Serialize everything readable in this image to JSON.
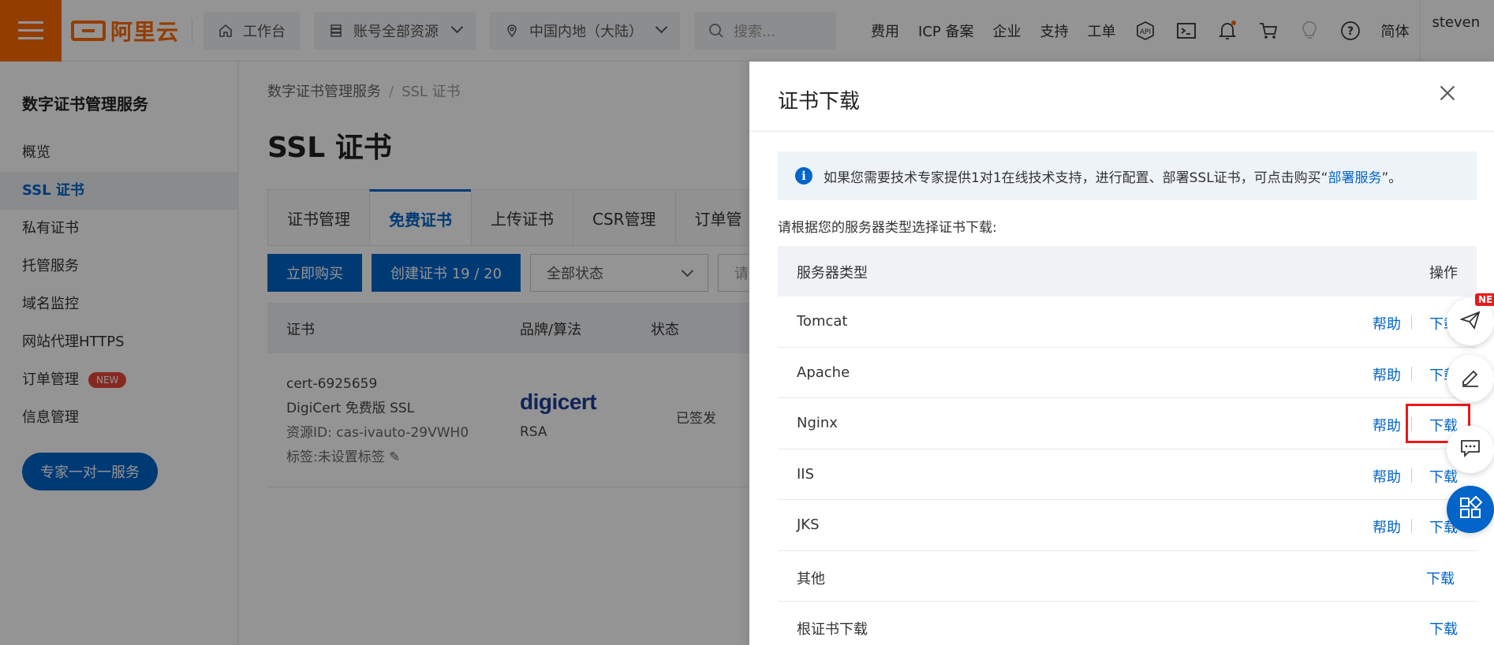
{
  "topbar": {
    "logo_text": "阿里云",
    "workbench": "工作台",
    "account_resources": "账号全部资源",
    "region": "中国内地（大陆）",
    "search_placeholder": "搜索...",
    "links": [
      "费用",
      "ICP 备案",
      "企业",
      "支持",
      "工单"
    ],
    "language": "简体",
    "user": "steven"
  },
  "sidebar": {
    "title": "数字证书管理服务",
    "items": [
      {
        "label": "概览"
      },
      {
        "label": "SSL 证书",
        "active": true
      },
      {
        "label": "私有证书"
      },
      {
        "label": "托管服务"
      },
      {
        "label": "域名监控"
      },
      {
        "label": "网站代理HTTPS"
      },
      {
        "label": "订单管理",
        "badge": "NEW"
      },
      {
        "label": "信息管理"
      }
    ],
    "expert_button": "专家一对一服务"
  },
  "main": {
    "breadcrumb": [
      "数字证书管理服务",
      "SSL 证书"
    ],
    "title": "SSL 证书",
    "tabs": [
      "证书管理",
      "免费证书",
      "上传证书",
      "CSR管理",
      "订单管"
    ],
    "active_tab": "免费证书",
    "buy_button": "立即购买",
    "create_button": "创建证书 19 / 20",
    "status_select": "全部状态",
    "input_stub": "请输",
    "table_headers": [
      "证书",
      "品牌/算法",
      "状态"
    ],
    "rows": [
      {
        "cert": "cert-6925659",
        "product": "DigiCert 免费版 SSL",
        "resource_id": "资源ID: cas-ivauto-29VWH0",
        "tag": "标签:未设置标签",
        "brand_logo": "digicert",
        "algorithm": "RSA",
        "status": "已签发"
      }
    ]
  },
  "drawer": {
    "title": "证书下载",
    "info_text": "如果您需要技术专家提供1对1在线技术支持，进行配置、部署SSL证书，可点击购买“",
    "info_link": "部署服务",
    "info_suffix": "”。",
    "select_label": "请根据您的服务器类型选择证书下载:",
    "col_server": "服务器类型",
    "col_action": "操作",
    "help_label": "帮助",
    "download_label": "下载",
    "servers": [
      {
        "name": "Tomcat",
        "help": "帮助",
        "download": "下载"
      },
      {
        "name": "Apache",
        "help": "帮助",
        "download": "下载"
      },
      {
        "name": "Nginx",
        "help": "帮助",
        "download": "下载",
        "highlighted": true
      },
      {
        "name": "IIS",
        "help": "帮助",
        "download": "下载"
      },
      {
        "name": "JKS",
        "help": "帮助",
        "download": "下载"
      },
      {
        "name": "其他",
        "download": "下载"
      },
      {
        "name": "根证书下载",
        "download": "下载"
      }
    ]
  },
  "float": {
    "new_tag": "NE"
  },
  "colors": {
    "brand_orange": "#ff6a00",
    "primary_blue": "#0064c8",
    "highlight_red": "#e81919"
  }
}
